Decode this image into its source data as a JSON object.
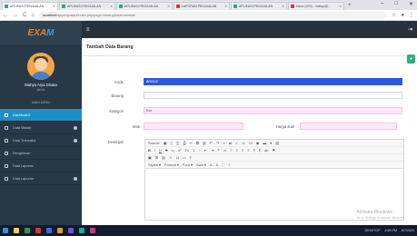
{
  "browser": {
    "tabs": [
      {
        "label": "APLIKASI PENJUALAN",
        "icon": "green"
      },
      {
        "label": "APLIKASI PENJUALAN",
        "icon": "green"
      },
      {
        "label": "APLIKASI PENJUALAN",
        "icon": "green"
      },
      {
        "label": "LAPORAN PENJUALAN",
        "icon": "red"
      },
      {
        "label": "APLIKASI PENJUALAN",
        "icon": "green"
      },
      {
        "label": "Inbox (470) - mahyu@...",
        "icon": "red"
      }
    ],
    "new_tab": "+",
    "window_controls": [
      "–",
      "□",
      "✕"
    ],
    "nav": {
      "back": "←",
      "forward": "→",
      "reload": "C",
      "home": "⌂"
    },
    "url_host": "localhost",
    "url_path": "/aplpenjualan/index.php/page=barang&alat=tambah"
  },
  "sidebar": {
    "user_name": "Wahyu Arya Dinata",
    "user_role": "admin",
    "menu_header": "MAIN MENU",
    "items": [
      {
        "label": "Dashboard",
        "active": true,
        "badge": false
      },
      {
        "label": "Data Master",
        "active": false,
        "badge": true
      },
      {
        "label": "Data Transaksi",
        "active": false,
        "badge": true
      },
      {
        "label": "Pengeluran",
        "active": false,
        "badge": false
      },
      {
        "label": "Data Laporan",
        "active": false,
        "badge": false
      },
      {
        "label": "Data Laporan",
        "active": false,
        "badge": true
      }
    ]
  },
  "topbar": {
    "menu_icon": "≡",
    "right_icon": "⇥"
  },
  "form": {
    "title": "Tambah Data Barang",
    "kode_label": "Kode",
    "kode_value": "BR0012",
    "barang_label": "Barang",
    "barang_value": "",
    "kategori_label": "Kategori",
    "kategori_value": "Kch",
    "stok_label": "Stok",
    "stok_value": "",
    "harga_label": "Harga Jual",
    "harga_value": "",
    "deskripsi_label": "Deskripsi"
  },
  "editor": {
    "toolbar_row1": [
      "Source",
      "Save",
      "New",
      "Preview",
      "Print",
      "Templates",
      "Cut",
      "Copy",
      "Paste",
      "Undo",
      "Redo",
      "Find",
      "Replace",
      "Spell",
      "Form",
      "Checkbox",
      "Radio",
      "Textfield",
      "Select",
      "Button",
      "Image"
    ],
    "toolbar_row2": [
      "B",
      "I",
      "U",
      "S",
      "x₂",
      "x²",
      "Tx",
      "1.",
      "•",
      "⇤",
      "⇥",
      "❝",
      "▭",
      "≡",
      "≡",
      "≡",
      "≡",
      "¶",
      "¶",
      "ab",
      "⚑"
    ],
    "toolbar_row3": [
      "▣",
      "⊞",
      "▤",
      "☺",
      "Ω",
      "▭",
      "≡"
    ],
    "styles": "Styles",
    "format": "Format",
    "font": "Font",
    "size": "Size",
    "extra": [
      "A",
      "A",
      "⛶",
      "?"
    ]
  },
  "watermark": {
    "title": "Activate Windows",
    "sub": "Go to Settings to activate Windows."
  },
  "taskbar": {
    "tray": "DESKTOP",
    "time": "8:55 PM",
    "date": "6/7/2020"
  }
}
